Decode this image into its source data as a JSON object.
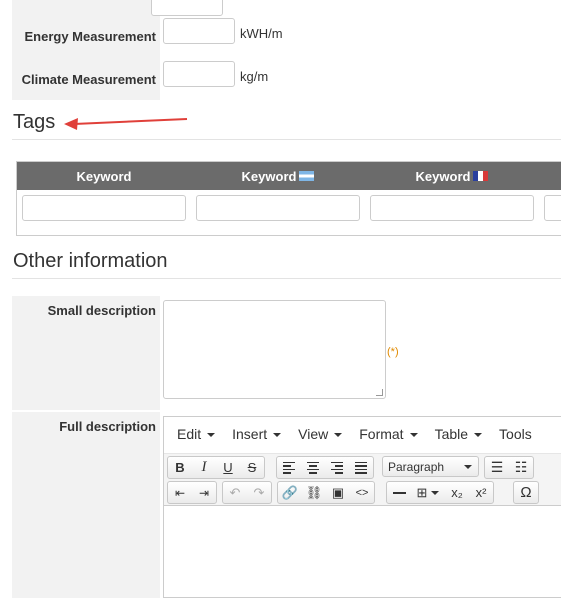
{
  "measurements": [
    {
      "label": "Energy Measurement",
      "unit": "kWH/m"
    },
    {
      "label": "Climate Measurement",
      "unit": "kg/m"
    }
  ],
  "tags": {
    "title": "Tags",
    "columns": [
      {
        "label": "Keyword",
        "flag": ""
      },
      {
        "label": "Keyword",
        "flag": "argentina-flag"
      },
      {
        "label": "Keyword",
        "flag": "france-flag"
      }
    ]
  },
  "other_information": {
    "title": "Other information",
    "small_description_label": "Small description",
    "required_mark": "(*)",
    "full_description_label": "Full description"
  },
  "editor": {
    "menus": [
      "Edit",
      "Insert",
      "View",
      "Format",
      "Table",
      "Tools"
    ],
    "format_select": "Paragraph",
    "toolbar_icons_row1": [
      "bold-icon",
      "italic-icon",
      "underline-icon",
      "strikethrough-icon",
      "align-left-icon",
      "align-center-icon",
      "align-right-icon",
      "align-justify-icon",
      "bullet-list-icon",
      "numbered-list-icon"
    ],
    "toolbar_icons_row2": [
      "outdent-icon",
      "indent-icon",
      "undo-icon",
      "redo-icon",
      "link-icon",
      "unlink-icon",
      "image-icon",
      "code-icon",
      "horizontal-rule-icon",
      "table-icon",
      "subscript-icon",
      "superscript-icon",
      "special-character-icon"
    ],
    "labels": {
      "bold": "B",
      "italic": "I",
      "underline": "U",
      "strike": "S",
      "sub": "x₂",
      "sup": "x²",
      "omega": "Ω",
      "code": "<>"
    }
  },
  "annotation": {
    "arrow_color": "#e0403a"
  }
}
